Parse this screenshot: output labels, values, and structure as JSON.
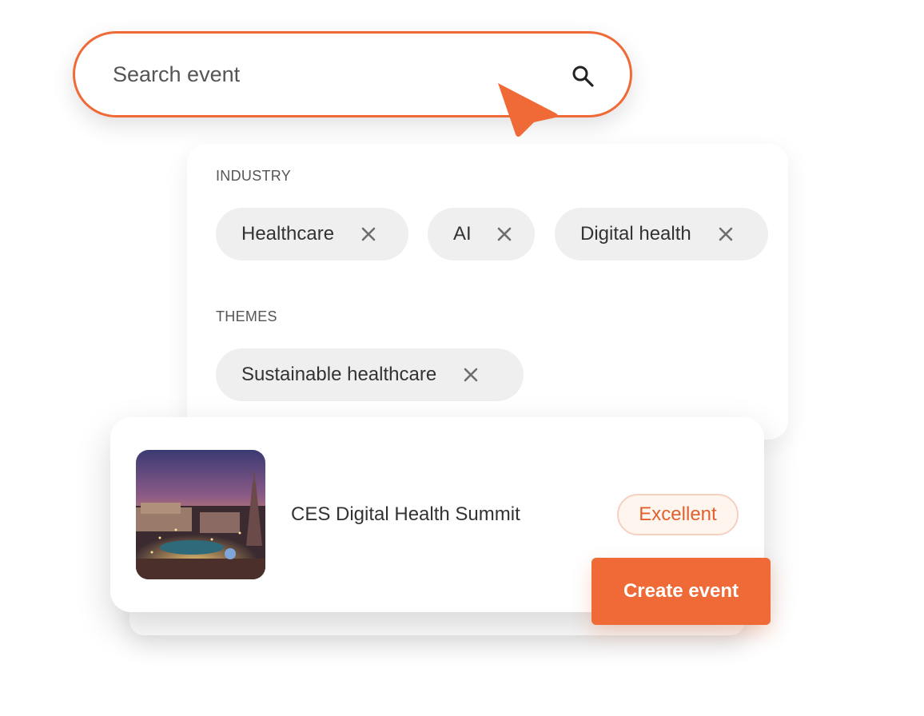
{
  "search": {
    "placeholder": "Search event",
    "value": "",
    "icon": "search-icon"
  },
  "filters": {
    "industry": {
      "label": "INDUSTRY",
      "chips": [
        {
          "label": "Healthcare",
          "remove_icon": "close-icon"
        },
        {
          "label": "AI",
          "remove_icon": "close-icon"
        },
        {
          "label": "Digital health",
          "remove_icon": "close-icon"
        }
      ]
    },
    "themes": {
      "label": "THEMES",
      "chips": [
        {
          "label": "Sustainable healthcare",
          "remove_icon": "close-icon"
        }
      ]
    }
  },
  "event": {
    "title": "CES Digital Health Summit",
    "rating": "Excellent",
    "thumbnail": "las-vegas-strip-photo"
  },
  "actions": {
    "create_label": "Create event"
  },
  "colors": {
    "accent": "#ef6a36",
    "badge_text": "#e0612f",
    "badge_bg": "#fff5ef",
    "chip_bg": "#efefef"
  }
}
